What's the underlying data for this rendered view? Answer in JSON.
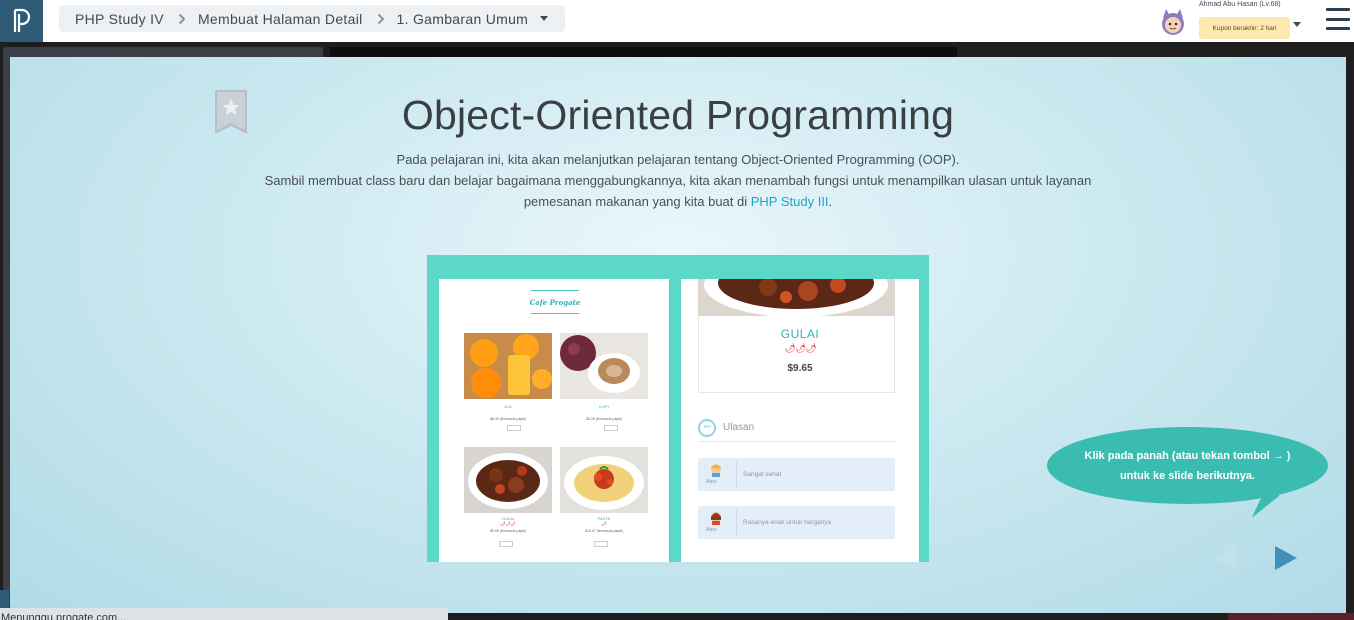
{
  "header": {
    "breadcrumb": [
      "PHP Study IV",
      "Membuat Halaman Detail",
      "1. Gambaran Umum"
    ],
    "user_name": "Ahmad Abu Hasan (Lv.68)",
    "coupon_text": "Kupon berakhir: 2 hari"
  },
  "slide": {
    "title": "Object-Oriented Programming",
    "description_line1": "Pada pelajaran ini, kita akan melanjutkan pelajaran tentang Object-Oriented Programming (OOP).",
    "description_line2": "Sambil membuat class baru dan belajar bagaimana menggabungkannya, kita akan menambah fungsi untuk menampilkan ulasan untuk layanan",
    "description_line3_prefix": "pemesanan makanan yang kita buat di ",
    "description_link": "PHP Study III",
    "description_line3_suffix": ".",
    "preview": {
      "cafe_name": "Cafe Progate",
      "items": [
        {
          "name": "JUS",
          "price": "$6.49 (termasuk pajak)"
        },
        {
          "name": "KOPI",
          "price": "$3.25 (termasuk pajak)"
        },
        {
          "name": "GULAI",
          "spice": "🌶🌶🌶",
          "price": "$9.65 (termasuk pajak)"
        },
        {
          "name": "PASTA",
          "spice": "🌶",
          "price": "$12.07 (termasuk pajak)"
        }
      ],
      "detail_name": "GULAI",
      "detail_spice": "🌶🌶🌶",
      "detail_price": "$9.65",
      "reviews_title": "Ulasan",
      "reviews": [
        {
          "user": "Alex",
          "text": "Sangat sehat"
        },
        {
          "user": "Alex",
          "text": "Rasanya enak untuk harganya"
        }
      ]
    },
    "tooltip": "Klik pada panah (atau tekan tombol → ) untuk ke slide berikutnya."
  },
  "status": {
    "loading_text": "Menunggu progate.com..."
  },
  "colors": {
    "accent": "#3bbcb0",
    "link": "#1aa6c7",
    "nav_arrow": "#3f90ba",
    "logo_bg": "#2f5a78"
  }
}
